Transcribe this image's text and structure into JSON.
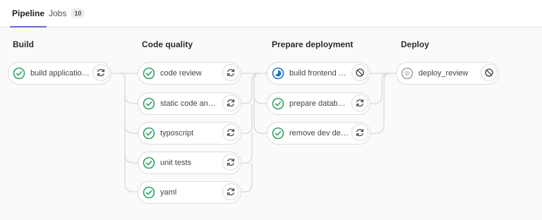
{
  "tabs": [
    {
      "label": "Pipeline",
      "active": true
    },
    {
      "label": "Jobs",
      "badge": "10"
    }
  ],
  "stages": [
    {
      "title": "Build",
      "jobs": [
        {
          "name": "build application ...",
          "status": "success",
          "action": "retry"
        }
      ]
    },
    {
      "title": "Code quality",
      "jobs": [
        {
          "name": "code review",
          "status": "success",
          "action": "retry"
        },
        {
          "name": "static code analy...",
          "status": "success",
          "action": "retry"
        },
        {
          "name": "typoscript",
          "status": "success",
          "action": "retry"
        },
        {
          "name": "unit tests",
          "status": "success",
          "action": "retry"
        },
        {
          "name": "yaml",
          "status": "success",
          "action": "retry"
        }
      ]
    },
    {
      "title": "Prepare deployment",
      "jobs": [
        {
          "name": "build frontend as...",
          "status": "running",
          "action": "cancel"
        },
        {
          "name": "prepare databas...",
          "status": "success",
          "action": "retry"
        },
        {
          "name": "remove dev dep...",
          "status": "success",
          "action": "retry"
        }
      ]
    },
    {
      "title": "Deploy",
      "jobs": [
        {
          "name": "deploy_review",
          "status": "created",
          "action": "cancel"
        }
      ]
    }
  ],
  "colors": {
    "success": "#2da160",
    "running": "#1f75cb",
    "created": "#a4a3a8",
    "tab_active": "#6b68d6"
  },
  "icons": {
    "success": "check-circle-icon",
    "running": "running-circle-icon",
    "created": "pending-circle-icon",
    "retry": "retry-icon",
    "cancel": "cancel-icon"
  }
}
